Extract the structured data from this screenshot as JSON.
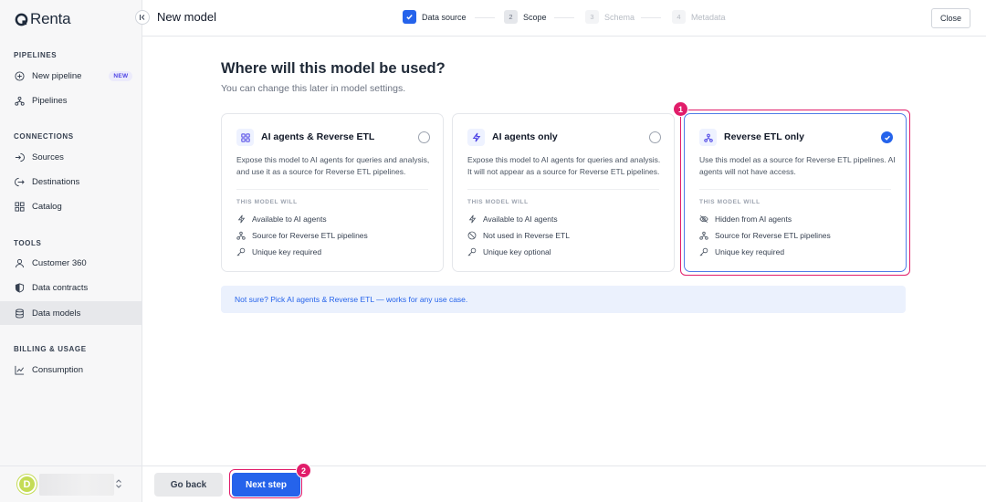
{
  "app": {
    "logo_text": "Renta"
  },
  "sidebar": {
    "sections": [
      {
        "label": "PIPELINES",
        "items": [
          {
            "label": "New pipeline",
            "icon": "plus-circle-icon",
            "badge": "NEW"
          },
          {
            "label": "Pipelines",
            "icon": "hierarchy-icon"
          }
        ]
      },
      {
        "label": "CONNECTIONS",
        "items": [
          {
            "label": "Sources",
            "icon": "login-icon"
          },
          {
            "label": "Destinations",
            "icon": "logout-icon"
          },
          {
            "label": "Catalog",
            "icon": "grid-icon"
          }
        ]
      },
      {
        "label": "TOOLS",
        "items": [
          {
            "label": "Customer 360",
            "icon": "user-icon"
          },
          {
            "label": "Data contracts",
            "icon": "shield-icon"
          },
          {
            "label": "Data models",
            "icon": "database-icon",
            "active": true
          }
        ]
      },
      {
        "label": "BILLING & USAGE",
        "items": [
          {
            "label": "Consumption",
            "icon": "chart-line-icon"
          }
        ]
      }
    ],
    "user": {
      "avatar_letter": "D",
      "avatar_color": "#c4dc55"
    }
  },
  "header": {
    "title": "New model",
    "steps": [
      {
        "num": "1",
        "label": "Data source",
        "state": "done"
      },
      {
        "num": "2",
        "label": "Scope",
        "state": "current"
      },
      {
        "num": "3",
        "label": "Schema",
        "state": "pending"
      },
      {
        "num": "4",
        "label": "Metadata",
        "state": "pending"
      }
    ],
    "close_label": "Close"
  },
  "main": {
    "title": "Where will this model be used?",
    "subtitle": "You can change this later in model settings.",
    "will_label": "THIS MODEL WILL",
    "cards": [
      {
        "title": "AI agents & Reverse ETL",
        "icon": "grid-icon",
        "description": "Expose this model to AI agents for queries and analysis, and use it as a source for Reverse ETL pipelines.",
        "features": [
          {
            "icon": "bolt-icon",
            "text": "Available to AI agents"
          },
          {
            "icon": "hierarchy-icon",
            "text": "Source for Reverse ETL pipelines"
          },
          {
            "icon": "key-icon",
            "text": "Unique key required"
          }
        ],
        "selected": false
      },
      {
        "title": "AI agents only",
        "icon": "bolt-icon",
        "description": "Expose this model to AI agents for queries and analysis. It will not appear as a source for Reverse ETL pipelines.",
        "features": [
          {
            "icon": "bolt-icon",
            "text": "Available to AI agents"
          },
          {
            "icon": "ban-icon",
            "text": "Not used in Reverse ETL"
          },
          {
            "icon": "key-icon",
            "text": "Unique key optional"
          }
        ],
        "selected": false
      },
      {
        "title": "Reverse ETL only",
        "icon": "hierarchy-icon",
        "description": "Use this model as a source for Reverse ETL pipelines. AI agents will not have access.",
        "features": [
          {
            "icon": "eye-off-icon",
            "text": "Hidden from AI agents"
          },
          {
            "icon": "hierarchy-icon",
            "text": "Source for Reverse ETL pipelines"
          },
          {
            "icon": "key-icon",
            "text": "Unique key required"
          }
        ],
        "selected": true
      }
    ],
    "hint": "Not sure? Pick AI agents & Reverse ETL — works for any use case."
  },
  "footer": {
    "back_label": "Go back",
    "next_label": "Next step"
  },
  "annotations": [
    {
      "num": "1"
    },
    {
      "num": "2"
    }
  ],
  "colors": {
    "accent": "#2563eb",
    "annotation": "#e11d6a"
  }
}
